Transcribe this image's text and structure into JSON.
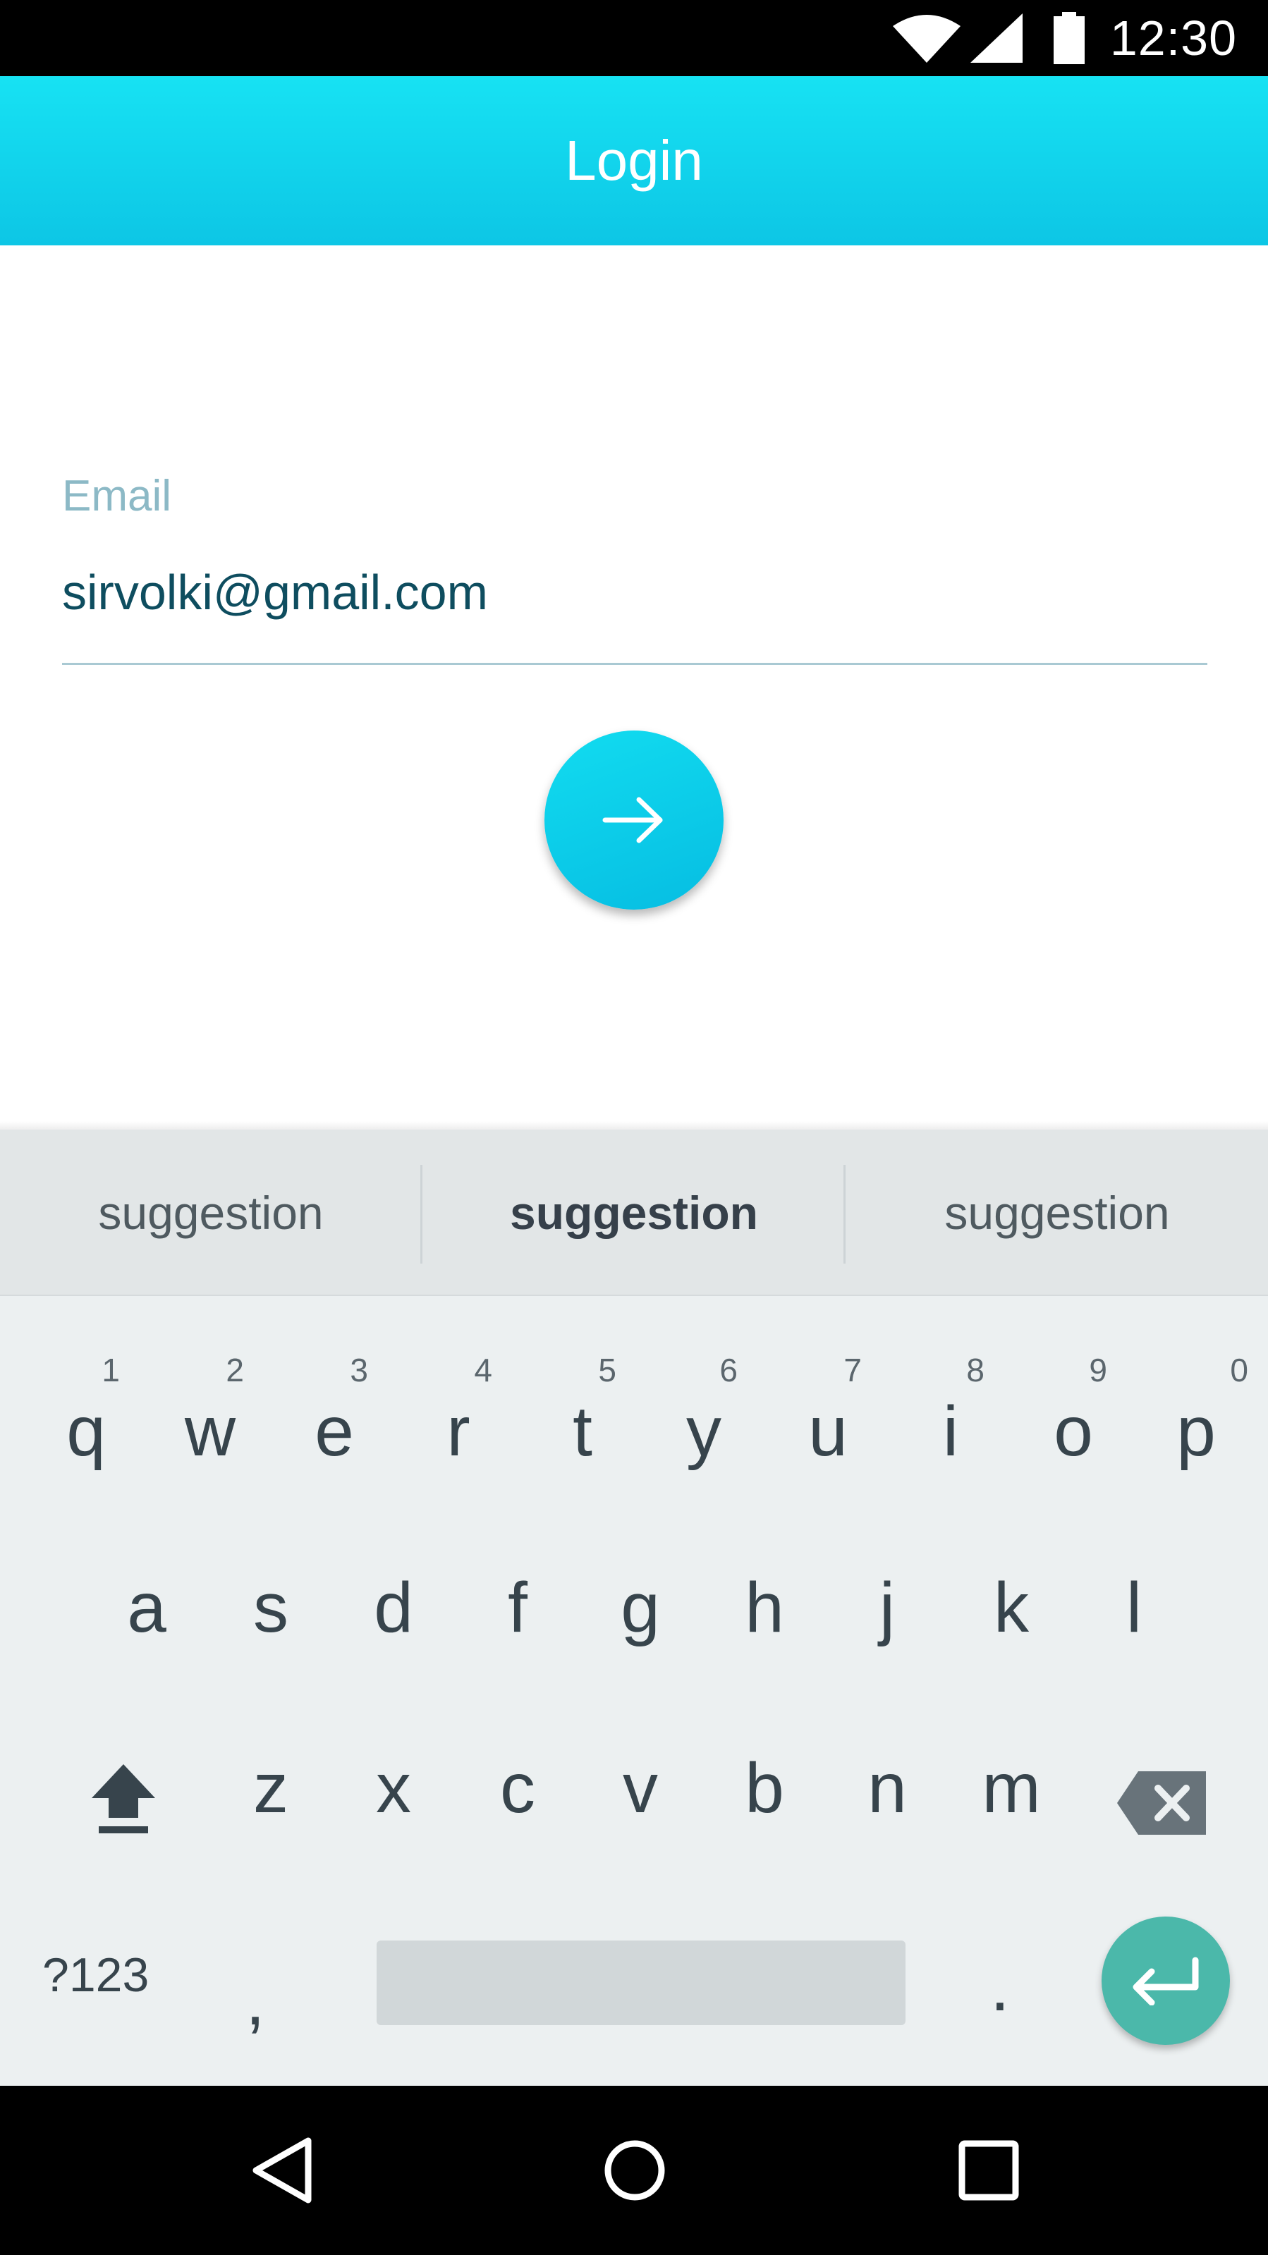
{
  "status_bar": {
    "time": "12:30"
  },
  "app_bar": {
    "title": "Login"
  },
  "form": {
    "email_label": "Email",
    "email_value": "sirvolki@gmail.com"
  },
  "suggestions": [
    "suggestion",
    "suggestion",
    "suggestion"
  ],
  "keyboard": {
    "row1": [
      {
        "ch": "q",
        "num": "1"
      },
      {
        "ch": "w",
        "num": "2"
      },
      {
        "ch": "e",
        "num": "3"
      },
      {
        "ch": "r",
        "num": "4"
      },
      {
        "ch": "t",
        "num": "5"
      },
      {
        "ch": "y",
        "num": "6"
      },
      {
        "ch": "u",
        "num": "7"
      },
      {
        "ch": "i",
        "num": "8"
      },
      {
        "ch": "o",
        "num": "9"
      },
      {
        "ch": "p",
        "num": "0"
      }
    ],
    "row2": [
      "a",
      "s",
      "d",
      "f",
      "g",
      "h",
      "j",
      "k",
      "l"
    ],
    "row3": [
      "z",
      "x",
      "c",
      "v",
      "b",
      "n",
      "m"
    ],
    "symbols_label": "?123",
    "comma": ",",
    "period": ".",
    "icons": {
      "shift": "shift-icon",
      "backspace": "backspace-icon",
      "enter": "enter-icon"
    }
  },
  "colors": {
    "app_bar": "#0dc6e5",
    "fab": "#06bde2",
    "enter_key": "#4bb8aa",
    "email_text": "#0e4d5f",
    "label": "#8cb9c6"
  }
}
